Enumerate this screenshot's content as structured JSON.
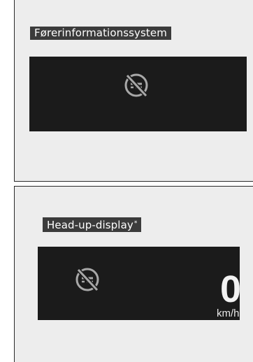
{
  "driver_info": {
    "title": "Førerinformationssystem",
    "icon": "cruise-control-off-icon"
  },
  "hud": {
    "title": "Head-up-display",
    "title_marker": "*",
    "icon": "cruise-control-off-icon",
    "speed_value": "0",
    "speed_unit": "km/h"
  },
  "colors": {
    "panel_bg": "#ededed",
    "screen_bg": "#1b1b1b",
    "label_bg": "#3b3b3b",
    "icon_stroke": "#a8a8a8"
  }
}
